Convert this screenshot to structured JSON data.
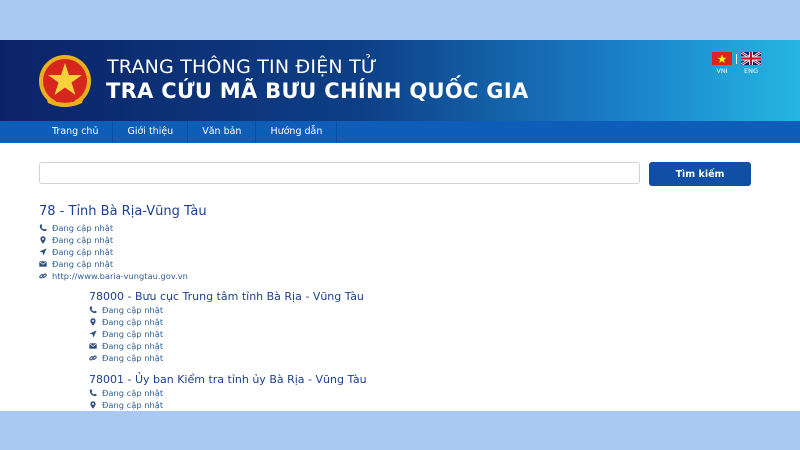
{
  "header": {
    "line1": "TRANG THÔNG TIN ĐIỆN TỬ",
    "line2": "TRA CỨU MÃ BƯU CHÍNH QUỐC GIA",
    "emblem_icon": "national-emblem-icon",
    "languages": [
      {
        "label": "VNI",
        "icon": "vietnam-flag-icon"
      },
      {
        "label": "ENG",
        "icon": "uk-flag-icon"
      }
    ]
  },
  "nav": {
    "items": [
      "Trang chủ",
      "Giới thiệu",
      "Văn bản",
      "Hướng dẫn"
    ]
  },
  "search": {
    "value": "",
    "placeholder": "",
    "button_label": "Tìm kiếm"
  },
  "province": {
    "title": "78 - Tỉnh Bà Rịa-Vũng Tàu",
    "phone": "Đang cập nhật",
    "address": "Đang cập nhật",
    "location": "Đang cập nhật",
    "email": "Đang cập nhật",
    "website": "http://www.baria-vungtau.gov.vn"
  },
  "offices": [
    {
      "title": "78000 - Bưu cục Trung tâm tỉnh Bà Rịa - Vũng Tàu",
      "phone": "Đang cập nhật",
      "address": "Đang cập nhật",
      "location": "Đang cập nhật",
      "email": "Đang cập nhật",
      "website": "Đang cập nhật"
    },
    {
      "title": "78001 - Ủy ban Kiểm tra tỉnh ủy Bà Rịa - Vũng Tàu",
      "phone": "Đang cập nhật",
      "address": "Đang cập nhật"
    }
  ],
  "colors": {
    "header_start": "#0c2368",
    "header_end": "#24b6e2",
    "nav": "#0d5db9",
    "button": "#0f4fa6",
    "link": "#1c3f91",
    "page_background": "#aac8f4"
  }
}
